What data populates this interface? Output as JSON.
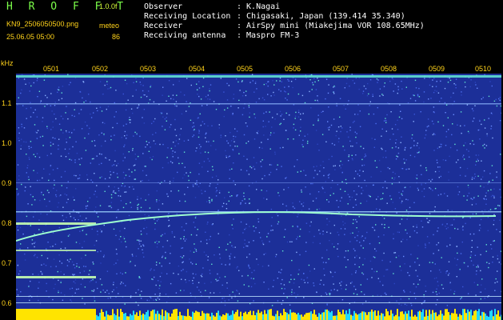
{
  "header": {
    "app_title": "H R O F F T",
    "gain": "1.0.0f",
    "filename": "KN9_2506050500.png",
    "meteo_label": "meteo",
    "datetime": "25.06.05 05:00",
    "meteo_value": "86"
  },
  "info": [
    {
      "label": "Observer",
      "value": ": K.Nagai"
    },
    {
      "label": "Receiving Location",
      "value": ": Chigasaki, Japan (139.414 35.340)"
    },
    {
      "label": "Receiver",
      "value": ": AirSpy mini (Miakejima VOR 108.65MHz)"
    },
    {
      "label": "Receiving antenna",
      "value": ": Maspro FM-3"
    }
  ],
  "axis": {
    "unit": "kHz",
    "y_ticks": [
      "1.1",
      "1.0",
      "0.9",
      "0.8",
      "0.7",
      "0.6"
    ],
    "x_ticks": [
      "0501",
      "0502",
      "0503",
      "0504",
      "0505",
      "0506",
      "0507",
      "0508",
      "0509",
      "0510"
    ]
  },
  "colors": {
    "background": "#1c2f98",
    "text_yellow": "#ffd21a",
    "title_green": "#7cff4a",
    "trace": "#9fffd0",
    "bar_yellow": "#ffe400",
    "bar_cyan": "#20d8ff"
  }
}
